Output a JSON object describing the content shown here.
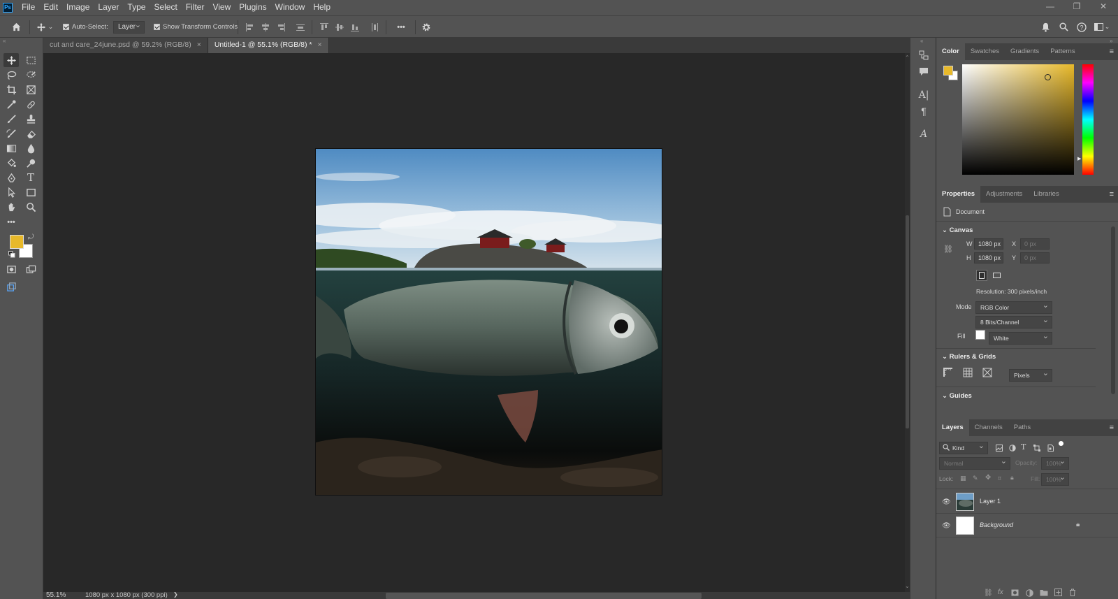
{
  "app": {
    "logo": "Ps"
  },
  "menu": [
    "File",
    "Edit",
    "Image",
    "Layer",
    "Type",
    "Select",
    "Filter",
    "View",
    "Plugins",
    "Window",
    "Help"
  ],
  "options": {
    "auto_select_label": "Auto-Select:",
    "auto_select_value": "Layer",
    "transform_label": "Show Transform Controls",
    "more": "•••"
  },
  "tabs": [
    {
      "label": "cut and care_24june.psd @ 59.2% (RGB/8)",
      "close": "×"
    },
    {
      "label": "Untitled-1 @ 55.1% (RGB/8) *",
      "close": "×"
    }
  ],
  "status": {
    "zoom": "55.1%",
    "info": "1080 px x 1080 px (300 ppi)",
    "arrow": "❯"
  },
  "color_panel": {
    "tabs": [
      "Color",
      "Swatches",
      "Gradients",
      "Patterns"
    ],
    "foreground": "#e8b92a",
    "background": "#ffffff"
  },
  "properties": {
    "tabs": [
      "Properties",
      "Adjustments",
      "Libraries"
    ],
    "doc_label": "Document",
    "canvas_title": "Canvas",
    "w_label": "W",
    "w_value": "1080 px",
    "h_label": "H",
    "h_value": "1080 px",
    "x_label": "X",
    "x_value": "0 px",
    "y_label": "Y",
    "y_value": "0 px",
    "resolution": "Resolution: 300 pixels/inch",
    "mode_label": "Mode",
    "mode_value": "RGB Color",
    "depth_value": "8 Bits/Channel",
    "fill_label": "Fill",
    "fill_value": "White",
    "rulers_title": "Rulers & Grids",
    "units_value": "Pixels",
    "guides_title": "Guides"
  },
  "layers_panel": {
    "tabs": [
      "Layers",
      "Channels",
      "Paths"
    ],
    "kind": "Kind",
    "blend": "Normal",
    "opacity_label": "Opacity:",
    "opacity_value": "100%",
    "lock_label": "Lock:",
    "fill_label": "Fill:",
    "fill_value": "100%",
    "layers": [
      {
        "name": "Layer 1"
      },
      {
        "name": "Background"
      }
    ],
    "footer_fx": "fx"
  }
}
